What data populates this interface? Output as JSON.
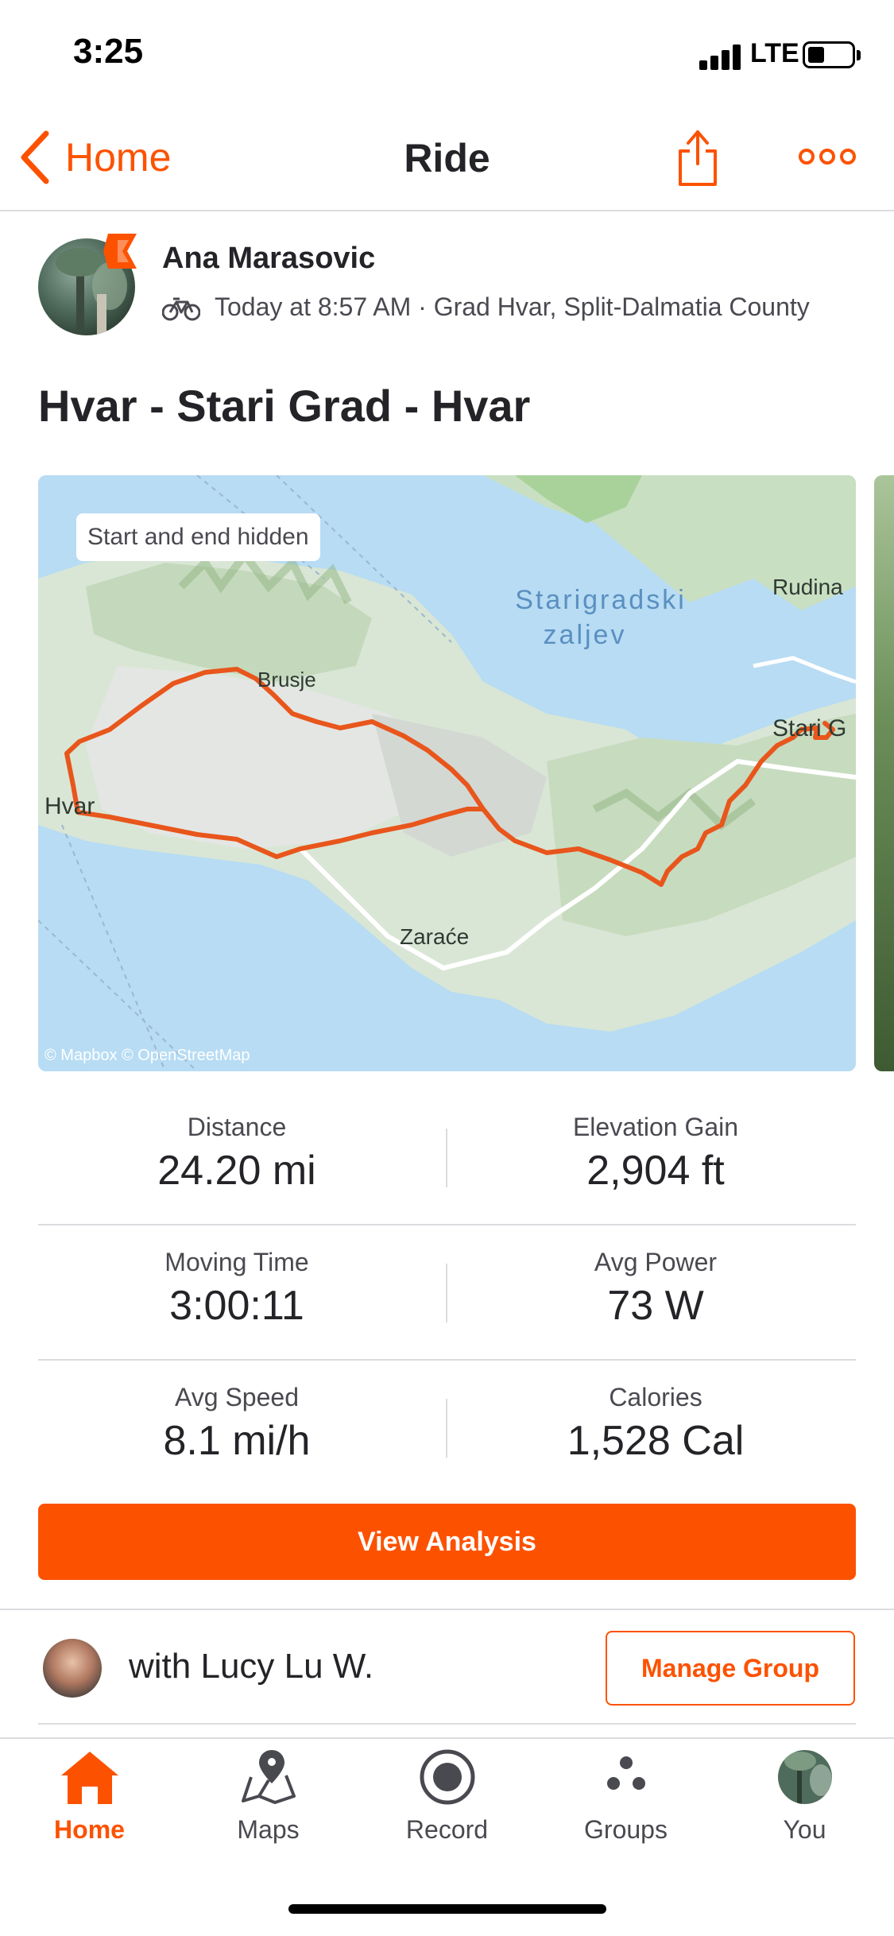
{
  "status_bar": {
    "time": "3:25",
    "network": "LTE"
  },
  "nav": {
    "back_label": "Home",
    "title": "Ride"
  },
  "activity": {
    "athlete_name": "Ana Marasovic",
    "meta": "Today at 8:57 AM · Grad Hvar, Split-Dalmatia County",
    "title": "Hvar - Stari Grad - Hvar",
    "type_icon": "bike-icon"
  },
  "map": {
    "privacy_chip": "Start and end hidden",
    "labels": [
      "Starigradski",
      "zaljev",
      "Rudina",
      "Stari G",
      "Hvar",
      "Zaraće",
      "Brusje"
    ],
    "attribution": "© Mapbox © OpenStreetMap",
    "route_color": "#e8561c"
  },
  "stats": [
    {
      "label": "Distance",
      "value": "24.20 mi"
    },
    {
      "label": "Elevation Gain",
      "value": "2,904 ft"
    },
    {
      "label": "Moving Time",
      "value": "3:00:11"
    },
    {
      "label": "Avg Power",
      "value": "73 W"
    },
    {
      "label": "Avg Speed",
      "value": "8.1 mi/h"
    },
    {
      "label": "Calories",
      "value": "1,528 Cal"
    }
  ],
  "actions": {
    "view_analysis": "View Analysis",
    "manage_group": "Manage Group"
  },
  "group": {
    "with_text": "with Lucy Lu W."
  },
  "tabs": [
    {
      "label": "Home",
      "icon": "house-icon",
      "active": true
    },
    {
      "label": "Maps",
      "icon": "map-pin-icon",
      "active": false
    },
    {
      "label": "Record",
      "icon": "record-icon",
      "active": false
    },
    {
      "label": "Groups",
      "icon": "groups-icon",
      "active": false
    },
    {
      "label": "You",
      "icon": "profile-avatar-icon",
      "active": false
    }
  ],
  "colors": {
    "accent": "#fc5200",
    "text": "#242428",
    "muted": "#494950",
    "divider": "#dcdce0"
  }
}
